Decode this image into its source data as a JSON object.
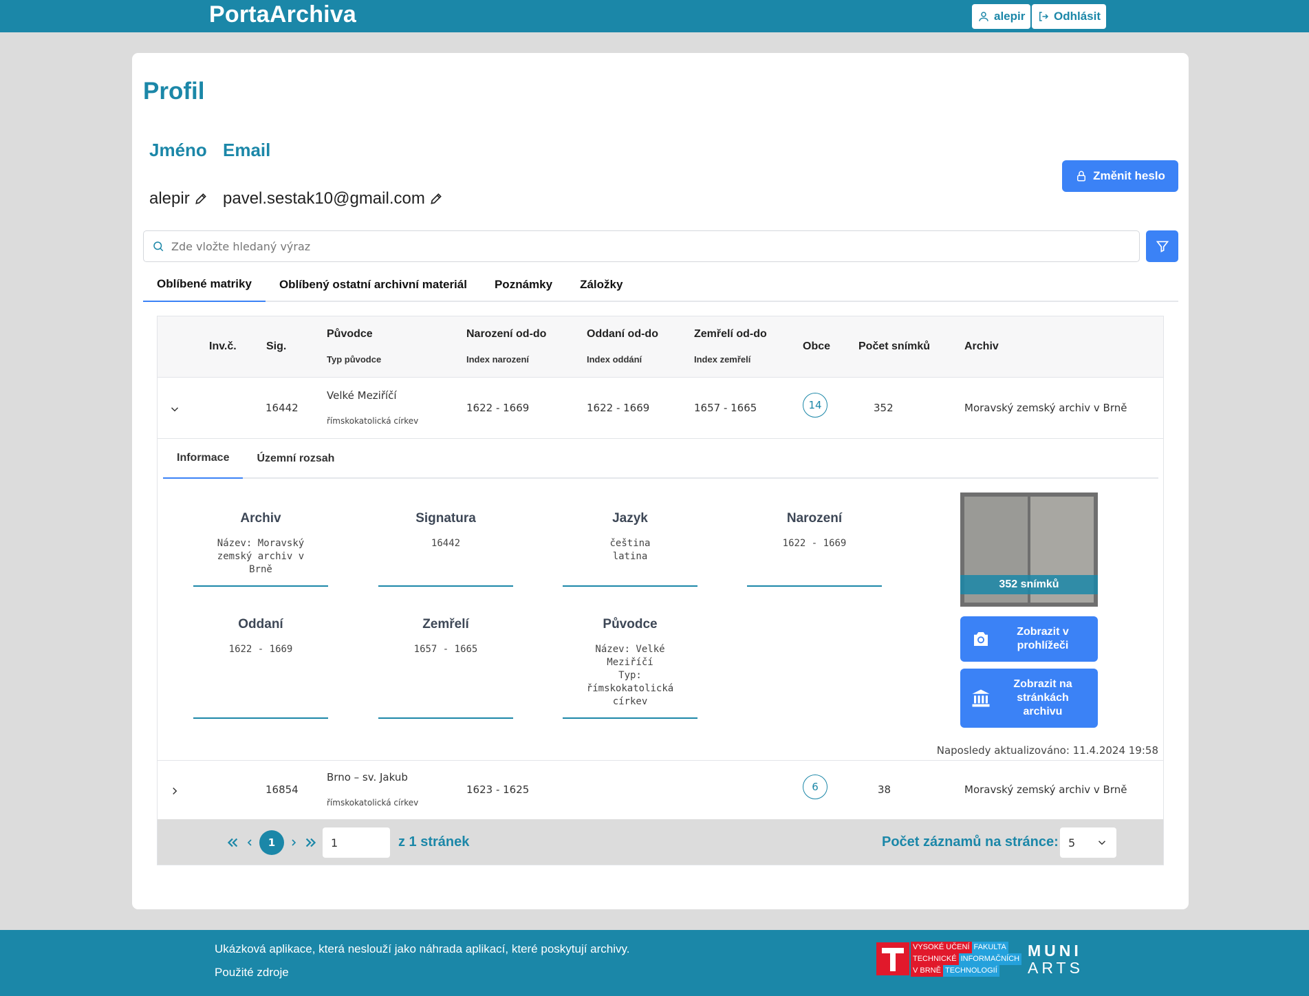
{
  "header": {
    "brand": "PortaArchiva",
    "user_label": "alepir",
    "logout_label": "Odhlásit"
  },
  "profile": {
    "title": "Profil",
    "name_label": "Jméno",
    "email_label": "Email",
    "name_value": "alepir",
    "email_value": "pavel.sestak10@gmail.com",
    "change_password_label": "Změnit heslo"
  },
  "search": {
    "placeholder": "Zde vložte hledaný výraz"
  },
  "tabs": [
    {
      "label": "Oblíbené matriky",
      "active": true
    },
    {
      "label": "Oblíbený ostatní archivní materiál",
      "active": false
    },
    {
      "label": "Poznámky",
      "active": false
    },
    {
      "label": "Záložky",
      "active": false
    }
  ],
  "table": {
    "headers": {
      "inv": "Inv.č.",
      "sig": "Sig.",
      "originator": "Původce",
      "originator_type": "Typ původce",
      "birth": "Narození od-do",
      "birth_index": "Index narození",
      "marriage": "Oddaní od-do",
      "marriage_index": "Index oddání",
      "death": "Zemřelí od-do",
      "death_index": "Index zemřelí",
      "towns": "Obce",
      "scans": "Počet snímků",
      "archive": "Archiv"
    },
    "rows": [
      {
        "sig": "16442",
        "originator": "Velké Meziříčí",
        "originator_type": "římskokatolická církev",
        "birth": "1622 - 1669",
        "marriage": "1622 - 1669",
        "death": "1657 - 1665",
        "towns": "14",
        "scans": "352",
        "archive": "Moravský zemský archiv v Brně"
      },
      {
        "sig": "16854",
        "originator": "Brno – sv. Jakub",
        "originator_type": "římskokatolická církev",
        "birth": "1623 - 1625",
        "marriage": "",
        "death": "",
        "towns": "6",
        "scans": "38",
        "archive": "Moravský zemský archiv v Brně"
      }
    ]
  },
  "detail": {
    "subtabs": [
      {
        "label": "Informace",
        "active": true
      },
      {
        "label": "Územní rozsah",
        "active": false
      }
    ],
    "blocks": {
      "archive": {
        "title": "Archiv",
        "text": "Název: Moravský\nzemský archiv v\nBrně"
      },
      "signature": {
        "title": "Signatura",
        "text": "16442"
      },
      "language": {
        "title": "Jazyk",
        "text": "čeština\nlatina"
      },
      "birth": {
        "title": "Narození",
        "text": "1622 - 1669"
      },
      "marriage": {
        "title": "Oddaní",
        "text": "1622 - 1669"
      },
      "death": {
        "title": "Zemřelí",
        "text": "1657 - 1665"
      },
      "originator": {
        "title": "Původce",
        "text": "Název: Velké\nMeziříčí\nTyp:\nřímskokatolická\ncírkev"
      }
    },
    "thumbnail_caption": "352 snímků",
    "view_in_viewer_label": "Zobrazit v prohlížeči",
    "view_on_archive_label": "Zobrazit na stránkách archivu",
    "last_updated": "Naposledy aktualizováno: 11.4.2024 19:58"
  },
  "pagination": {
    "current_page": "1",
    "page_input_value": "1",
    "total_label": "z 1 stránek",
    "rows_per_page_label": "Počet záznamů na stránce:",
    "rows_per_page_value": "5"
  },
  "footer": {
    "disclaimer": "Ukázková aplikace, která neslouží jako náhrada aplikací, které poskytují archivy.",
    "sources_link": "Použité zdroje",
    "vut_line1a": "VYSOKÉ UČENÍ",
    "vut_line1b": "FAKULTA",
    "vut_line2a": "TECHNICKÉ",
    "vut_line2b": "INFORMAČNÍCH",
    "vut_line3a": "V BRNĚ",
    "vut_line3b": "TECHNOLOGIÍ",
    "muni_line1": "MUNI",
    "muni_line2": "ARTS"
  },
  "colors": {
    "brand": "#1b87a8",
    "primary_button": "#3b82f6",
    "background": "#dcdcdc"
  }
}
